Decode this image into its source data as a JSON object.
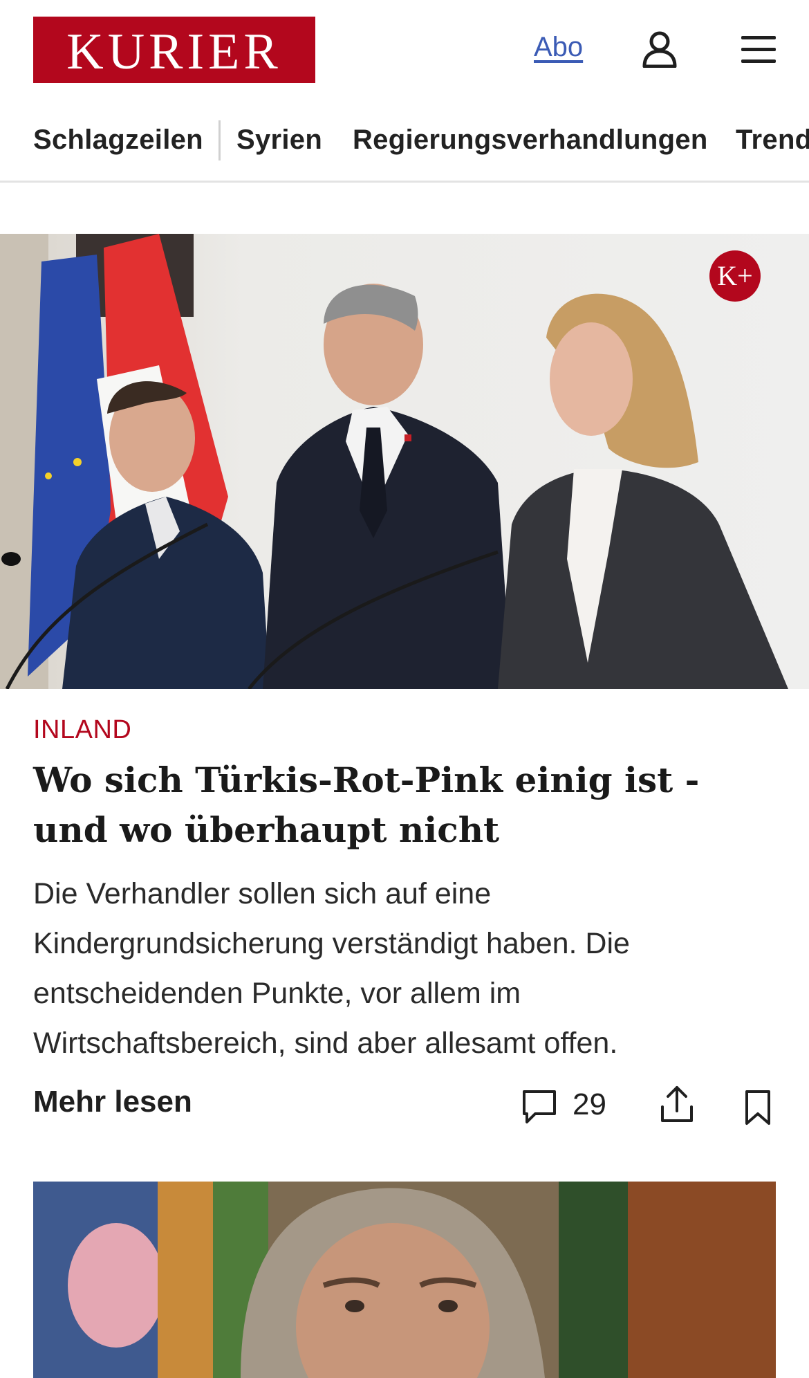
{
  "header": {
    "logo_text": "KURIER",
    "abo_label": "Abo",
    "user_icon": "user-icon",
    "menu_icon": "hamburger-menu-icon"
  },
  "nav": {
    "items": [
      {
        "label": "Schlagzeilen"
      },
      {
        "label": "Syrien"
      },
      {
        "label": "Regierungsverhandlungen"
      },
      {
        "label": "Trend"
      }
    ]
  },
  "article": {
    "premium_badge": "K+",
    "category": "INLAND",
    "headline": "Wo sich Türkis-Rot-Pink einig ist - und wo überhaupt nicht",
    "teaser": "Die Verhandler sollen sich auf eine Kindergrundsicherung verständigt haben. Die entscheidenden Punkte, vor allem im Wirtschaftsbereich, sind aber allesamt offen.",
    "more_label": "Mehr lesen",
    "comment_count": "29"
  },
  "colors": {
    "brand_red": "#b3071d",
    "link_blue": "#3b5bb5"
  }
}
